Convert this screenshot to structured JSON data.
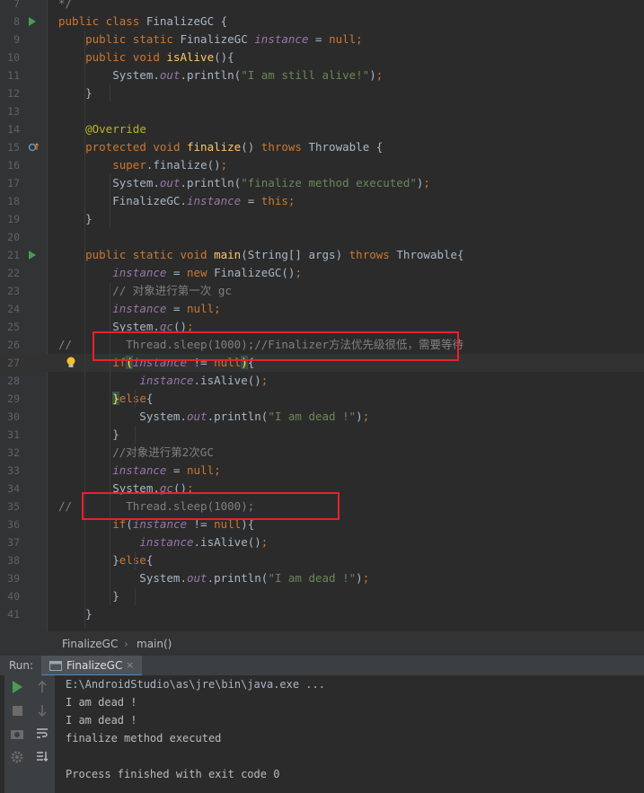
{
  "editor": {
    "lines": [
      {
        "n": "7",
        "segs": [
          [
            "cmt",
            "*/"
          ]
        ]
      },
      {
        "n": "8",
        "segs": [
          [
            "kw",
            "public class "
          ],
          [
            "plain",
            "FinalizeGC {"
          ]
        ]
      },
      {
        "n": "9",
        "segs": [
          [
            "plain",
            "    "
          ],
          [
            "kw",
            "public static "
          ],
          [
            "plain",
            "FinalizeGC "
          ],
          [
            "fld",
            "instance"
          ],
          [
            "plain",
            " = "
          ],
          [
            "kw",
            "null"
          ],
          [
            "kw",
            ";"
          ]
        ]
      },
      {
        "n": "10",
        "segs": [
          [
            "plain",
            "    "
          ],
          [
            "kw",
            "public void "
          ],
          [
            "fn",
            "isAlive"
          ],
          [
            "plain",
            "(){"
          ]
        ]
      },
      {
        "n": "11",
        "segs": [
          [
            "plain",
            "        System."
          ],
          [
            "fld",
            "out"
          ],
          [
            "plain",
            ".println("
          ],
          [
            "str",
            "\"I am still alive!\""
          ],
          [
            "plain",
            ")"
          ],
          [
            "kw",
            ";"
          ]
        ]
      },
      {
        "n": "12",
        "segs": [
          [
            "plain",
            "    }"
          ]
        ]
      },
      {
        "n": "13",
        "segs": []
      },
      {
        "n": "14",
        "segs": [
          [
            "plain",
            "    "
          ],
          [
            "ann",
            "@Override"
          ]
        ]
      },
      {
        "n": "15",
        "segs": [
          [
            "plain",
            "    "
          ],
          [
            "kw",
            "protected void "
          ],
          [
            "fn",
            "finalize"
          ],
          [
            "plain",
            "() "
          ],
          [
            "kw",
            "throws "
          ],
          [
            "plain",
            "Throwable {"
          ]
        ]
      },
      {
        "n": "16",
        "segs": [
          [
            "plain",
            "        "
          ],
          [
            "kw",
            "super"
          ],
          [
            "plain",
            ".finalize()"
          ],
          [
            "kw",
            ";"
          ]
        ]
      },
      {
        "n": "17",
        "segs": [
          [
            "plain",
            "        System."
          ],
          [
            "fld",
            "out"
          ],
          [
            "plain",
            ".println("
          ],
          [
            "str",
            "\"finalize method executed\""
          ],
          [
            "plain",
            ")"
          ],
          [
            "kw",
            ";"
          ]
        ]
      },
      {
        "n": "18",
        "segs": [
          [
            "plain",
            "        FinalizeGC."
          ],
          [
            "fld",
            "instance"
          ],
          [
            "plain",
            " = "
          ],
          [
            "kw",
            "this;"
          ]
        ]
      },
      {
        "n": "19",
        "segs": [
          [
            "plain",
            "    }"
          ]
        ]
      },
      {
        "n": "20",
        "segs": []
      },
      {
        "n": "21",
        "segs": [
          [
            "plain",
            "    "
          ],
          [
            "kw",
            "public static void "
          ],
          [
            "fn",
            "main"
          ],
          [
            "plain",
            "(String[] args) "
          ],
          [
            "kw",
            "throws "
          ],
          [
            "plain",
            "Throwable{"
          ]
        ]
      },
      {
        "n": "22",
        "segs": [
          [
            "plain",
            "        "
          ],
          [
            "fld",
            "instance"
          ],
          [
            "plain",
            " = "
          ],
          [
            "kw",
            "new "
          ],
          [
            "plain",
            "FinalizeGC()"
          ],
          [
            "kw",
            ";"
          ]
        ]
      },
      {
        "n": "23",
        "segs": [
          [
            "plain",
            "        "
          ],
          [
            "cmt",
            "// 对象进行第一次 gc"
          ]
        ]
      },
      {
        "n": "24",
        "segs": [
          [
            "plain",
            "        "
          ],
          [
            "fld",
            "instance"
          ],
          [
            "plain",
            " = "
          ],
          [
            "kw",
            "null"
          ],
          [
            "kw",
            ";"
          ]
        ]
      },
      {
        "n": "25",
        "segs": [
          [
            "plain",
            "        System."
          ],
          [
            "fld",
            "gc"
          ],
          [
            "plain",
            "()"
          ],
          [
            "kw",
            ";"
          ]
        ]
      },
      {
        "n": "26",
        "segs": [
          [
            "cmt",
            "//        Thread.sleep(1000);//Finalizer方法优先级很低，需要等待"
          ]
        ]
      },
      {
        "n": "27",
        "segs": [
          [
            "plain",
            "        "
          ],
          [
            "kw",
            "if"
          ],
          [
            "hl",
            "("
          ],
          [
            "fld",
            "instance"
          ],
          [
            "plain",
            " != "
          ],
          [
            "kw",
            "null"
          ],
          [
            "hl",
            ")"
          ],
          [
            "plain",
            "{"
          ]
        ]
      },
      {
        "n": "28",
        "segs": [
          [
            "plain",
            "            "
          ],
          [
            "fld",
            "instance"
          ],
          [
            "plain",
            ".isAlive()"
          ],
          [
            "kw",
            ";"
          ]
        ]
      },
      {
        "n": "29",
        "segs": [
          [
            "plain",
            "        "
          ],
          [
            "hl",
            "}"
          ],
          [
            "kw",
            "else"
          ],
          [
            "plain",
            "{"
          ]
        ]
      },
      {
        "n": "30",
        "segs": [
          [
            "plain",
            "            System."
          ],
          [
            "fld",
            "out"
          ],
          [
            "plain",
            ".println("
          ],
          [
            "str",
            "\"I am dead !\""
          ],
          [
            "plain",
            ")"
          ],
          [
            "kw",
            ";"
          ]
        ]
      },
      {
        "n": "31",
        "segs": [
          [
            "plain",
            "        }"
          ]
        ]
      },
      {
        "n": "32",
        "segs": [
          [
            "plain",
            "        "
          ],
          [
            "cmt",
            "//对象进行第2次GC"
          ]
        ]
      },
      {
        "n": "33",
        "segs": [
          [
            "plain",
            "        "
          ],
          [
            "fld",
            "instance"
          ],
          [
            "plain",
            " = "
          ],
          [
            "kw",
            "null"
          ],
          [
            "kw",
            ";"
          ]
        ]
      },
      {
        "n": "34",
        "segs": [
          [
            "plain",
            "        System."
          ],
          [
            "fld",
            "gc"
          ],
          [
            "plain",
            "()"
          ],
          [
            "kw",
            ";"
          ]
        ]
      },
      {
        "n": "35",
        "segs": [
          [
            "cmt",
            "//        Thread.sleep(1000);"
          ]
        ]
      },
      {
        "n": "36",
        "segs": [
          [
            "plain",
            "        "
          ],
          [
            "kw",
            "if"
          ],
          [
            "plain",
            "("
          ],
          [
            "fld",
            "instance"
          ],
          [
            "plain",
            " != "
          ],
          [
            "kw",
            "null"
          ],
          [
            "plain",
            "){"
          ]
        ]
      },
      {
        "n": "37",
        "segs": [
          [
            "plain",
            "            "
          ],
          [
            "fld",
            "instance"
          ],
          [
            "plain",
            ".isAlive()"
          ],
          [
            "kw",
            ";"
          ]
        ]
      },
      {
        "n": "38",
        "segs": [
          [
            "plain",
            "        }"
          ],
          [
            "kw",
            "else"
          ],
          [
            "plain",
            "{"
          ]
        ]
      },
      {
        "n": "39",
        "segs": [
          [
            "plain",
            "            System."
          ],
          [
            "fld",
            "out"
          ],
          [
            "plain",
            ".println("
          ],
          [
            "str",
            "\"I am dead !\""
          ],
          [
            "plain",
            ")"
          ],
          [
            "kw",
            ";"
          ]
        ]
      },
      {
        "n": "40",
        "segs": [
          [
            "plain",
            "        }"
          ]
        ]
      },
      {
        "n": "41",
        "segs": [
          [
            "plain",
            "    }"
          ]
        ]
      }
    ]
  },
  "breadcrumb": {
    "class_name": "FinalizeGC",
    "separator": "›",
    "method_name": "main()"
  },
  "run": {
    "label": "Run:",
    "tab_label": "FinalizeGC",
    "tab_close": "×",
    "console_lines": [
      "E:\\AndroidStudio\\as\\jre\\bin\\java.exe ...",
      "I am dead !",
      "I am dead !",
      "finalize method executed",
      "",
      "Process finished with exit code 0"
    ]
  },
  "colors": {
    "run_green": "#499c54",
    "highlight_red": "#e8222b",
    "bulb": "#f5c02b"
  }
}
